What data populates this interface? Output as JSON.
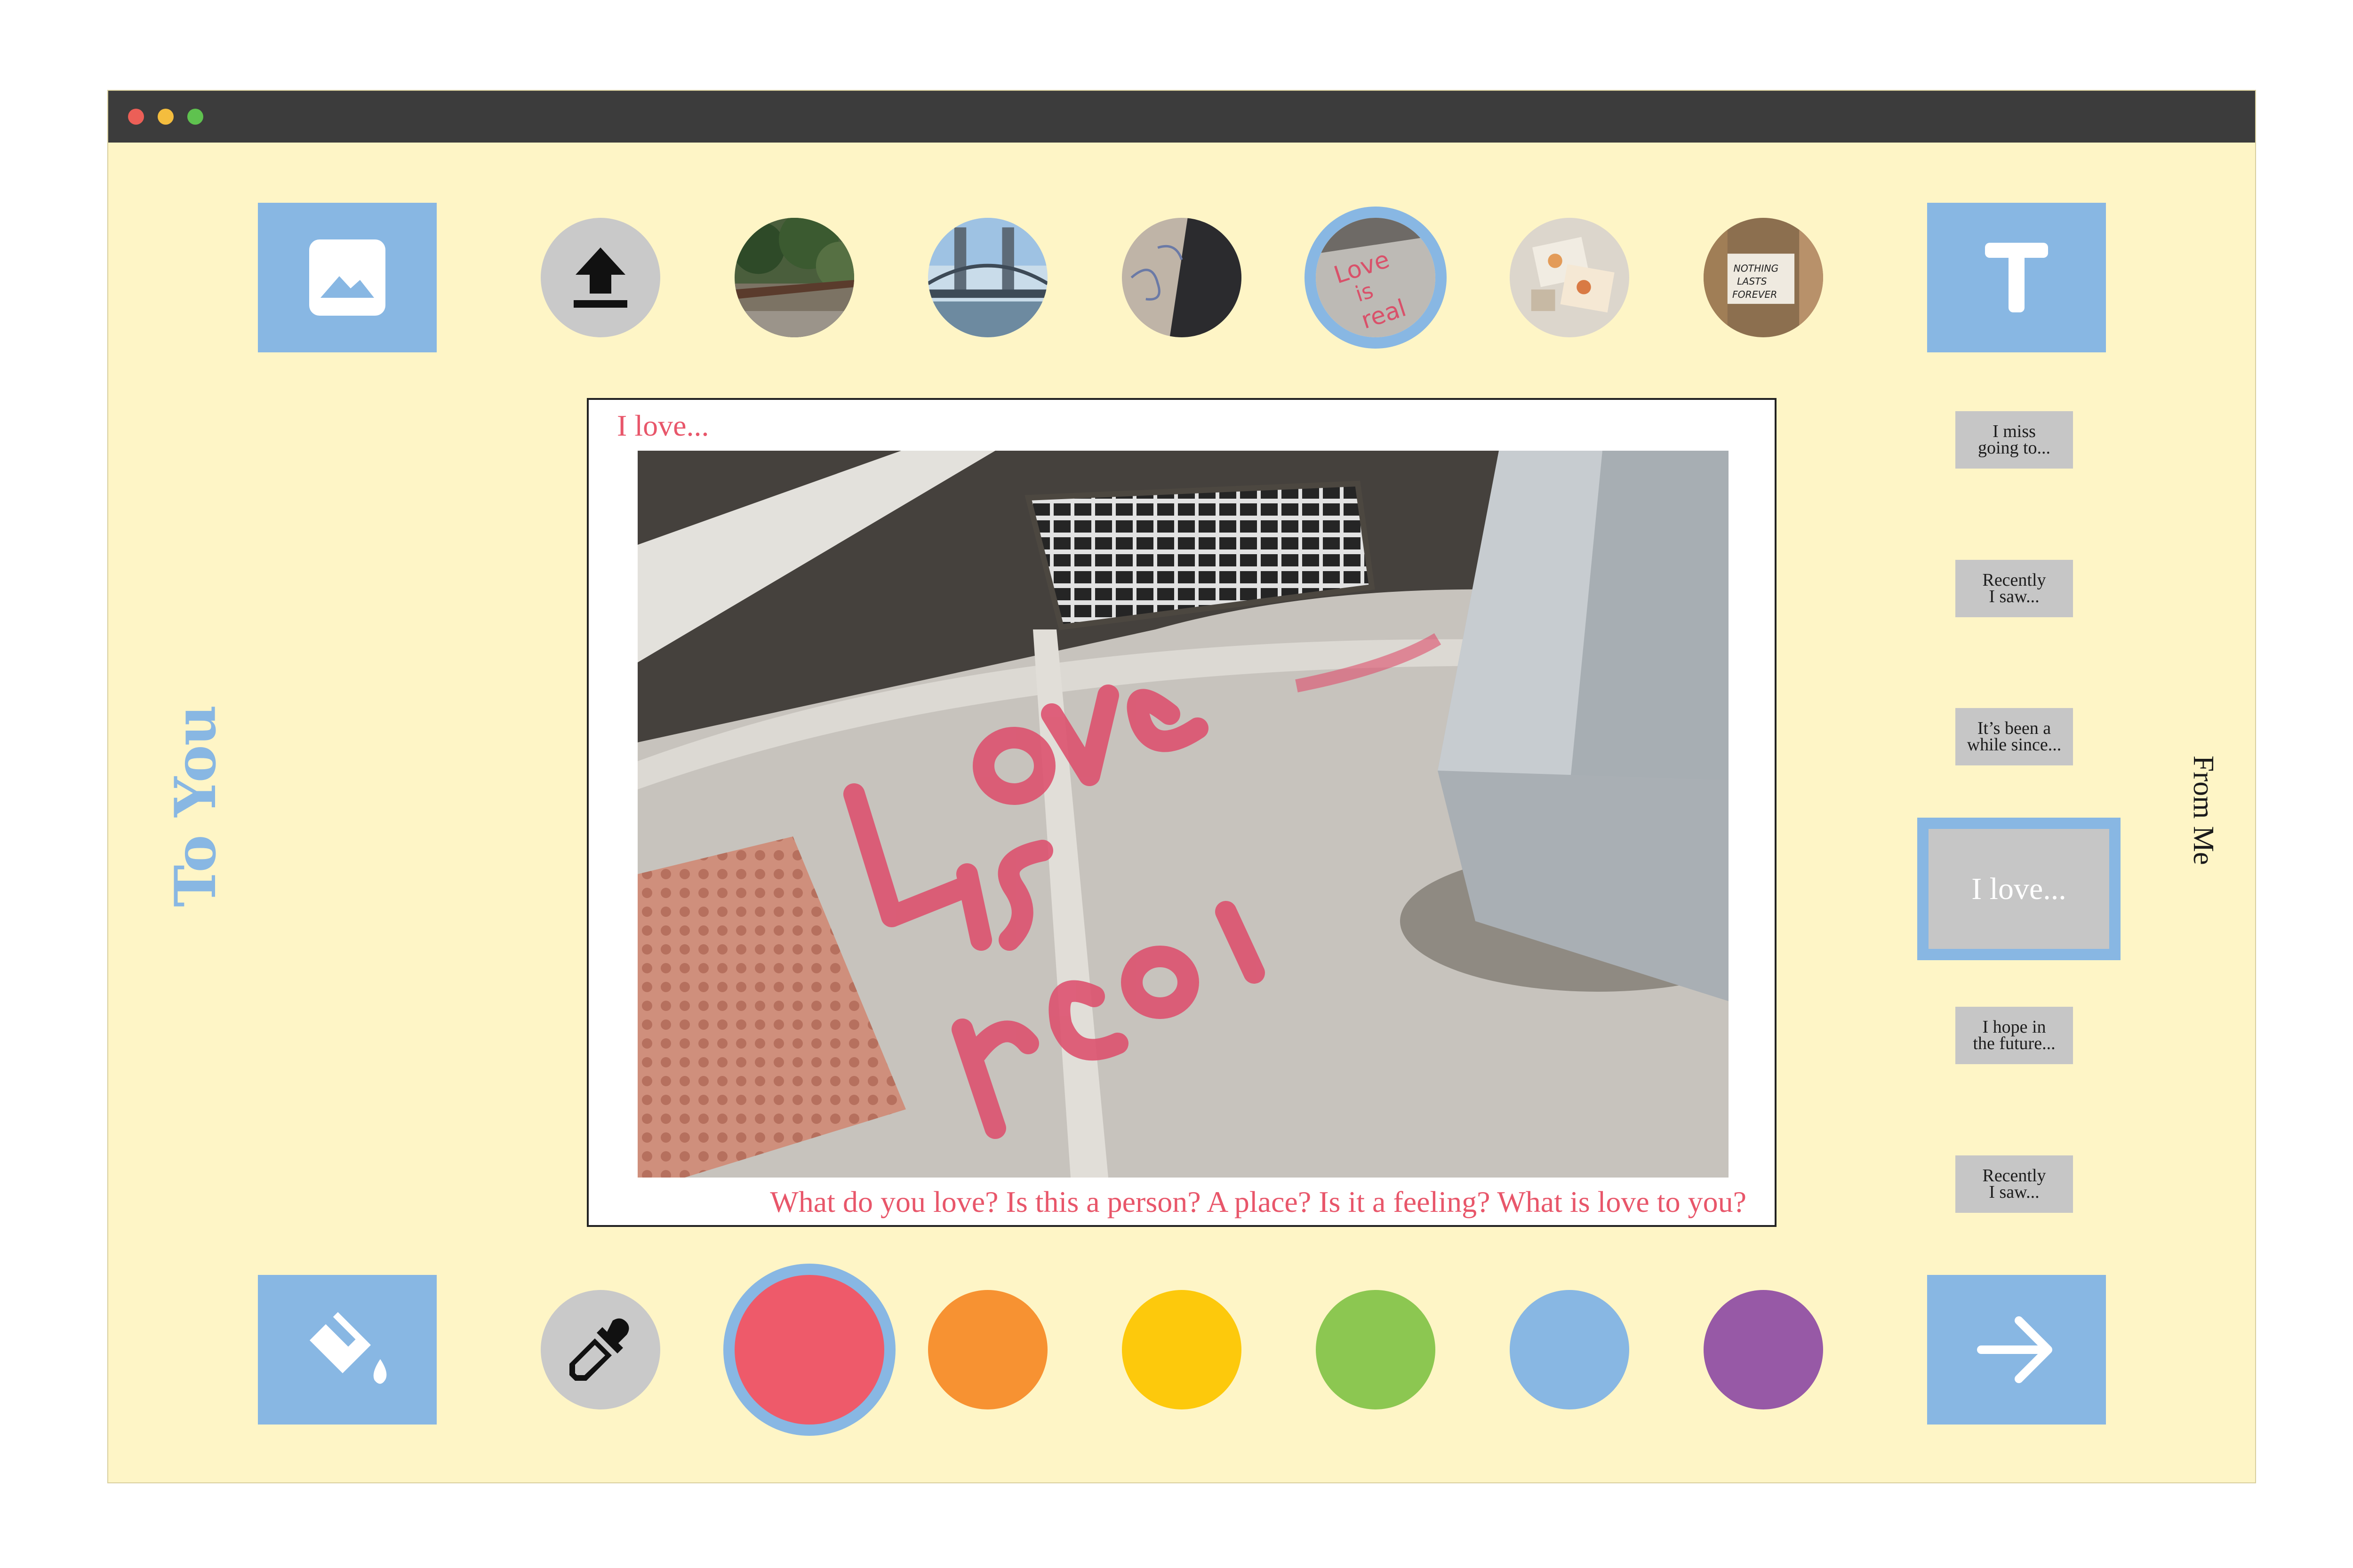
{
  "window": {
    "controls": [
      "close",
      "minimize",
      "maximize"
    ]
  },
  "labels": {
    "to": "To You",
    "from": "From Me"
  },
  "toolbar_top": {
    "image_tool_icon": "image-icon",
    "text_tool_icon": "text-t-icon",
    "upload_icon": "upload-icon",
    "photos": [
      {
        "name": "photo-waterfront-railing",
        "selected": false
      },
      {
        "name": "photo-bridge",
        "selected": false
      },
      {
        "name": "photo-sidewalk-chalk",
        "selected": false
      },
      {
        "name": "photo-love-is-real",
        "selected": true
      },
      {
        "name": "photo-postcards",
        "selected": false
      },
      {
        "name": "photo-nothing-lasts-forever",
        "selected": false
      }
    ]
  },
  "card": {
    "title": "I love...",
    "photo_text": "Love is real",
    "caption": "What do you love? Is this a person? A place? Is it a feeling? What is love to you?"
  },
  "prompts": [
    {
      "label": "I miss\ngoing to...",
      "selected": false
    },
    {
      "label": "Recently\nI saw...",
      "selected": false
    },
    {
      "label": "It’s been a\nwhile since...",
      "selected": false
    },
    {
      "label": "I love...",
      "selected": true
    },
    {
      "label": "I hope in\nthe future...",
      "selected": false
    },
    {
      "label": "Recently\nI saw...",
      "selected": false
    }
  ],
  "toolbar_bottom": {
    "fill_tool_icon": "paint-bucket-icon",
    "eyedropper_icon": "eyedropper-icon",
    "next_icon": "arrow-right-icon",
    "colors": [
      {
        "name": "red",
        "hex": "#ee5a6a",
        "selected": true
      },
      {
        "name": "orange",
        "hex": "#f79232",
        "selected": false
      },
      {
        "name": "yellow",
        "hex": "#fdc90c",
        "selected": false
      },
      {
        "name": "green",
        "hex": "#8cc751",
        "selected": false
      },
      {
        "name": "blue",
        "hex": "#88b7e3",
        "selected": false
      },
      {
        "name": "purple",
        "hex": "#9759a6",
        "selected": false
      }
    ]
  },
  "theme": {
    "background": "#fef5c6",
    "accent": "#88b7e3",
    "text_accent": "#e8566a"
  }
}
